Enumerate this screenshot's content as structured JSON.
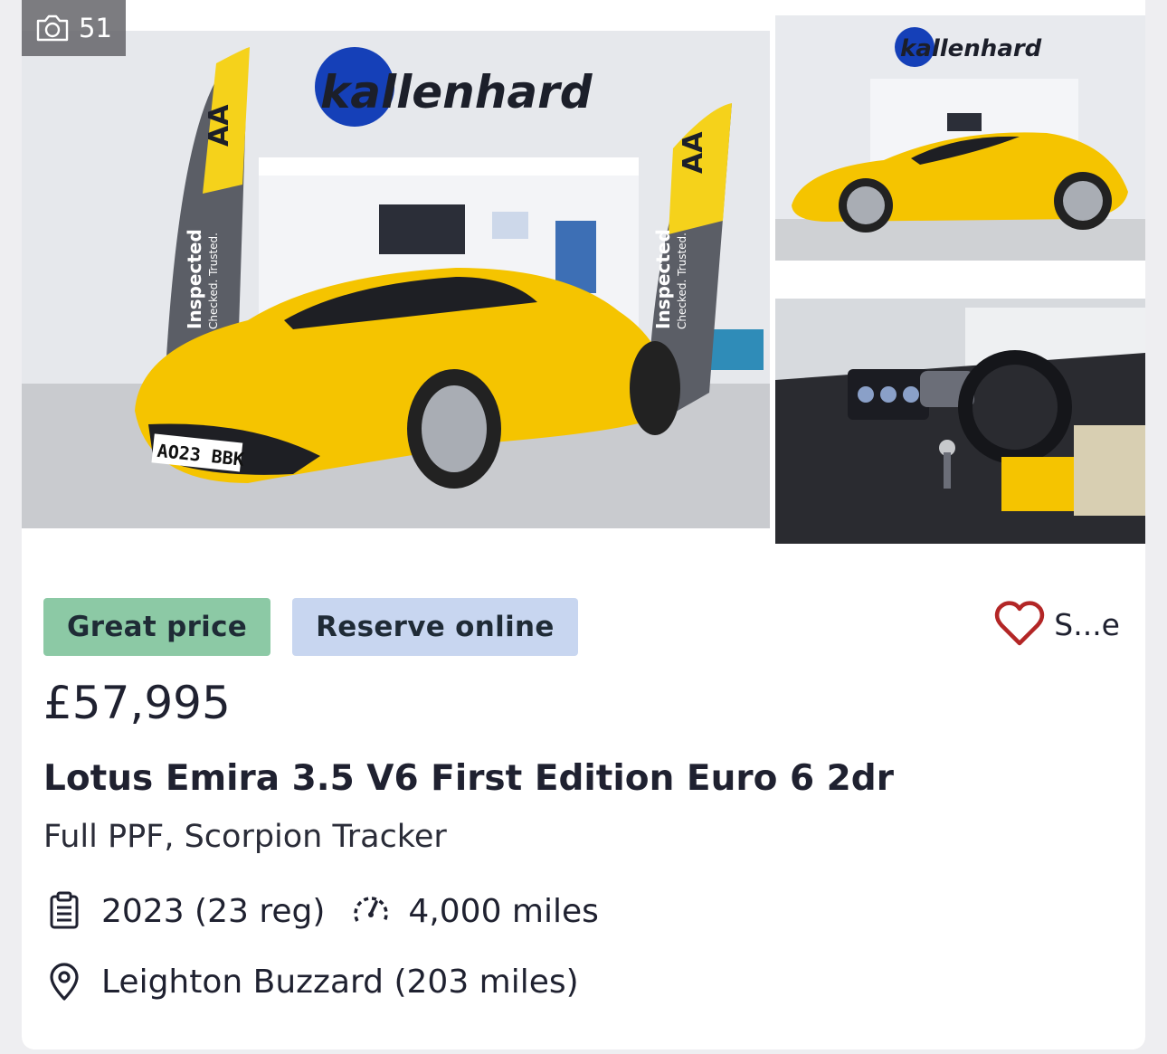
{
  "gallery": {
    "photo_count": "51",
    "images": [
      {
        "alt": "Yellow Lotus Emira in showroom",
        "plate": "AO23 BBK",
        "dealer_sign": "kallenhard",
        "flag_top": "AA",
        "flag_main": "Inspected",
        "flag_sub": "Checked. Trusted."
      },
      {
        "alt": "Yellow Lotus Emira side view",
        "dealer_sign": "kallenhard"
      },
      {
        "alt": "Lotus Emira interior dashboard"
      }
    ]
  },
  "badges": {
    "great_price": "Great price",
    "reserve_online": "Reserve online"
  },
  "save_label": "S...e",
  "price": "£57,995",
  "title": "Lotus Emira 3.5 V6 First Edition Euro 6 2dr",
  "subtitle": "Full PPF, Scorpion Tracker",
  "specs": {
    "year": "2023 (23 reg)",
    "mileage": "4,000 miles"
  },
  "location": "Leighton Buzzard (203 miles)",
  "colors": {
    "great_price_bg": "#8cc9a5",
    "reserve_bg": "#c8d6f0",
    "heart": "#b32626",
    "car_yellow": "#f5c400"
  }
}
